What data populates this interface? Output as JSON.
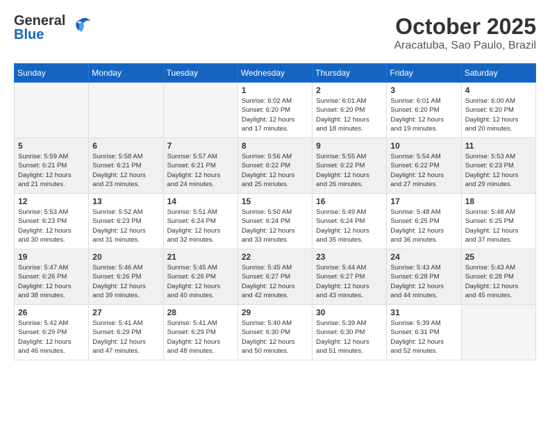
{
  "header": {
    "logo_general": "General",
    "logo_blue": "Blue",
    "month_title": "October 2025",
    "subtitle": "Aracatuba, Sao Paulo, Brazil"
  },
  "weekdays": [
    "Sunday",
    "Monday",
    "Tuesday",
    "Wednesday",
    "Thursday",
    "Friday",
    "Saturday"
  ],
  "weeks": [
    [
      {
        "day": "",
        "info": ""
      },
      {
        "day": "",
        "info": ""
      },
      {
        "day": "",
        "info": ""
      },
      {
        "day": "1",
        "info": "Sunrise: 6:02 AM\nSunset: 6:20 PM\nDaylight: 12 hours\nand 17 minutes."
      },
      {
        "day": "2",
        "info": "Sunrise: 6:01 AM\nSunset: 6:20 PM\nDaylight: 12 hours\nand 18 minutes."
      },
      {
        "day": "3",
        "info": "Sunrise: 6:01 AM\nSunset: 6:20 PM\nDaylight: 12 hours\nand 19 minutes."
      },
      {
        "day": "4",
        "info": "Sunrise: 6:00 AM\nSunset: 6:20 PM\nDaylight: 12 hours\nand 20 minutes."
      }
    ],
    [
      {
        "day": "5",
        "info": "Sunrise: 5:59 AM\nSunset: 6:21 PM\nDaylight: 12 hours\nand 21 minutes."
      },
      {
        "day": "6",
        "info": "Sunrise: 5:58 AM\nSunset: 6:21 PM\nDaylight: 12 hours\nand 23 minutes."
      },
      {
        "day": "7",
        "info": "Sunrise: 5:57 AM\nSunset: 6:21 PM\nDaylight: 12 hours\nand 24 minutes."
      },
      {
        "day": "8",
        "info": "Sunrise: 5:56 AM\nSunset: 6:22 PM\nDaylight: 12 hours\nand 25 minutes."
      },
      {
        "day": "9",
        "info": "Sunrise: 5:55 AM\nSunset: 6:22 PM\nDaylight: 12 hours\nand 26 minutes."
      },
      {
        "day": "10",
        "info": "Sunrise: 5:54 AM\nSunset: 6:22 PM\nDaylight: 12 hours\nand 27 minutes."
      },
      {
        "day": "11",
        "info": "Sunrise: 5:53 AM\nSunset: 6:23 PM\nDaylight: 12 hours\nand 29 minutes."
      }
    ],
    [
      {
        "day": "12",
        "info": "Sunrise: 5:53 AM\nSunset: 6:23 PM\nDaylight: 12 hours\nand 30 minutes."
      },
      {
        "day": "13",
        "info": "Sunrise: 5:52 AM\nSunset: 6:23 PM\nDaylight: 12 hours\nand 31 minutes."
      },
      {
        "day": "14",
        "info": "Sunrise: 5:51 AM\nSunset: 6:24 PM\nDaylight: 12 hours\nand 32 minutes."
      },
      {
        "day": "15",
        "info": "Sunrise: 5:50 AM\nSunset: 6:24 PM\nDaylight: 12 hours\nand 33 minutes."
      },
      {
        "day": "16",
        "info": "Sunrise: 5:49 AM\nSunset: 6:24 PM\nDaylight: 12 hours\nand 35 minutes."
      },
      {
        "day": "17",
        "info": "Sunrise: 5:48 AM\nSunset: 6:25 PM\nDaylight: 12 hours\nand 36 minutes."
      },
      {
        "day": "18",
        "info": "Sunrise: 5:48 AM\nSunset: 6:25 PM\nDaylight: 12 hours\nand 37 minutes."
      }
    ],
    [
      {
        "day": "19",
        "info": "Sunrise: 5:47 AM\nSunset: 6:26 PM\nDaylight: 12 hours\nand 38 minutes."
      },
      {
        "day": "20",
        "info": "Sunrise: 5:46 AM\nSunset: 6:26 PM\nDaylight: 12 hours\nand 39 minutes."
      },
      {
        "day": "21",
        "info": "Sunrise: 5:45 AM\nSunset: 6:26 PM\nDaylight: 12 hours\nand 40 minutes."
      },
      {
        "day": "22",
        "info": "Sunrise: 5:45 AM\nSunset: 6:27 PM\nDaylight: 12 hours\nand 42 minutes."
      },
      {
        "day": "23",
        "info": "Sunrise: 5:44 AM\nSunset: 6:27 PM\nDaylight: 12 hours\nand 43 minutes."
      },
      {
        "day": "24",
        "info": "Sunrise: 5:43 AM\nSunset: 6:28 PM\nDaylight: 12 hours\nand 44 minutes."
      },
      {
        "day": "25",
        "info": "Sunrise: 5:43 AM\nSunset: 6:28 PM\nDaylight: 12 hours\nand 45 minutes."
      }
    ],
    [
      {
        "day": "26",
        "info": "Sunrise: 5:42 AM\nSunset: 6:29 PM\nDaylight: 12 hours\nand 46 minutes."
      },
      {
        "day": "27",
        "info": "Sunrise: 5:41 AM\nSunset: 6:29 PM\nDaylight: 12 hours\nand 47 minutes."
      },
      {
        "day": "28",
        "info": "Sunrise: 5:41 AM\nSunset: 6:29 PM\nDaylight: 12 hours\nand 48 minutes."
      },
      {
        "day": "29",
        "info": "Sunrise: 5:40 AM\nSunset: 6:30 PM\nDaylight: 12 hours\nand 50 minutes."
      },
      {
        "day": "30",
        "info": "Sunrise: 5:39 AM\nSunset: 6:30 PM\nDaylight: 12 hours\nand 51 minutes."
      },
      {
        "day": "31",
        "info": "Sunrise: 5:39 AM\nSunset: 6:31 PM\nDaylight: 12 hours\nand 52 minutes."
      },
      {
        "day": "",
        "info": ""
      }
    ]
  ]
}
